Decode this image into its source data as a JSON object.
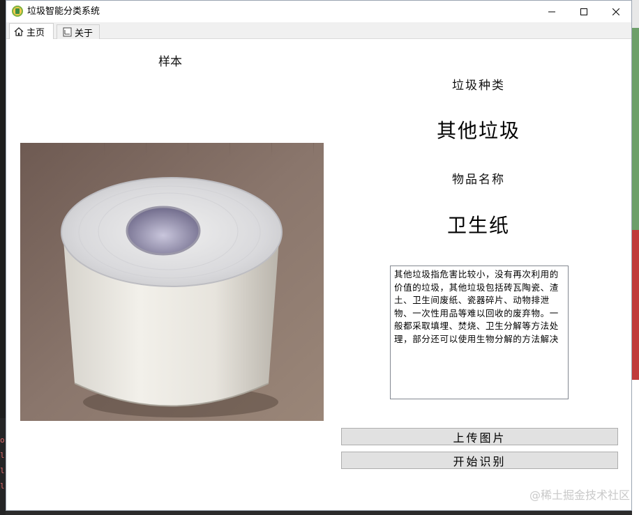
{
  "window": {
    "title": "垃圾智能分类系统"
  },
  "tabs": [
    {
      "label": "主页",
      "icon": "home-icon",
      "active": true
    },
    {
      "label": "关于",
      "icon": "document-icon",
      "active": false
    }
  ],
  "main": {
    "sample_label": "样本",
    "sample_image_icon": "toilet-paper-roll-photo",
    "category_label": "垃圾种类",
    "category_value": "其他垃圾",
    "item_label": "物品名称",
    "item_value": "卫生纸",
    "description": "其他垃圾指危害比较小，没有再次利用的价值的垃圾，其他垃圾包括砖瓦陶瓷、渣土、卫生间废纸、瓷器碎片、动物排泄物、一次性用品等难以回收的废弃物。一般都采取填埋、焚烧、卫生分解等方法处理，部分还可以使用生物分解的方法解决",
    "upload_button": "上传图片",
    "recognize_button": "开始识别"
  },
  "watermark": "@稀土掘金技术社区",
  "colors": {
    "window_bg": "#ffffff",
    "button_bg": "#e1e1e1",
    "button_border": "#adadad"
  }
}
